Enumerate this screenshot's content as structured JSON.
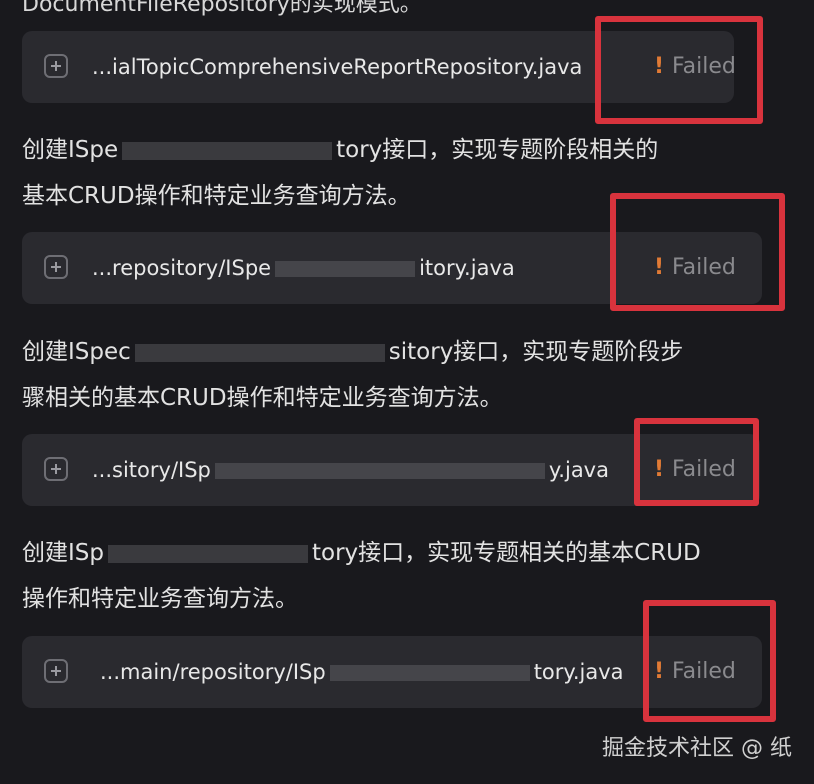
{
  "cut_text": "DocumentFileRepository的实现模式。",
  "items": [
    {
      "path_text": "...ialTopicComprehensiveReportRepository.java",
      "status": "Failed"
    },
    {
      "para_line1_a": "创建ISpe",
      "para_line1_b": "tory接口，实现专题阶段相关的",
      "para_line2": "基本CRUD操作和特定业务查询方法。",
      "path_a": "...repository/ISpe",
      "path_b": "itory.java",
      "status": "Failed"
    },
    {
      "para_line1_a": "创建ISpec",
      "para_line1_b": "sitory接口，实现专题阶段步",
      "para_line2": "骤相关的基本CRUD操作和特定业务查询方法。",
      "path_a": "...sitory/ISp",
      "path_b": "y.java",
      "status": "Failed"
    },
    {
      "para_line1_a": "创建ISp",
      "para_line1_b": "tory接口，实现专题相关的基本CRUD",
      "para_line2": "操作和特定业务查询方法。",
      "path_a": "...main/repository/ISp",
      "path_b": "tory.java",
      "status": "Failed"
    }
  ],
  "watermark": "掘金技术社区 @ 纸"
}
